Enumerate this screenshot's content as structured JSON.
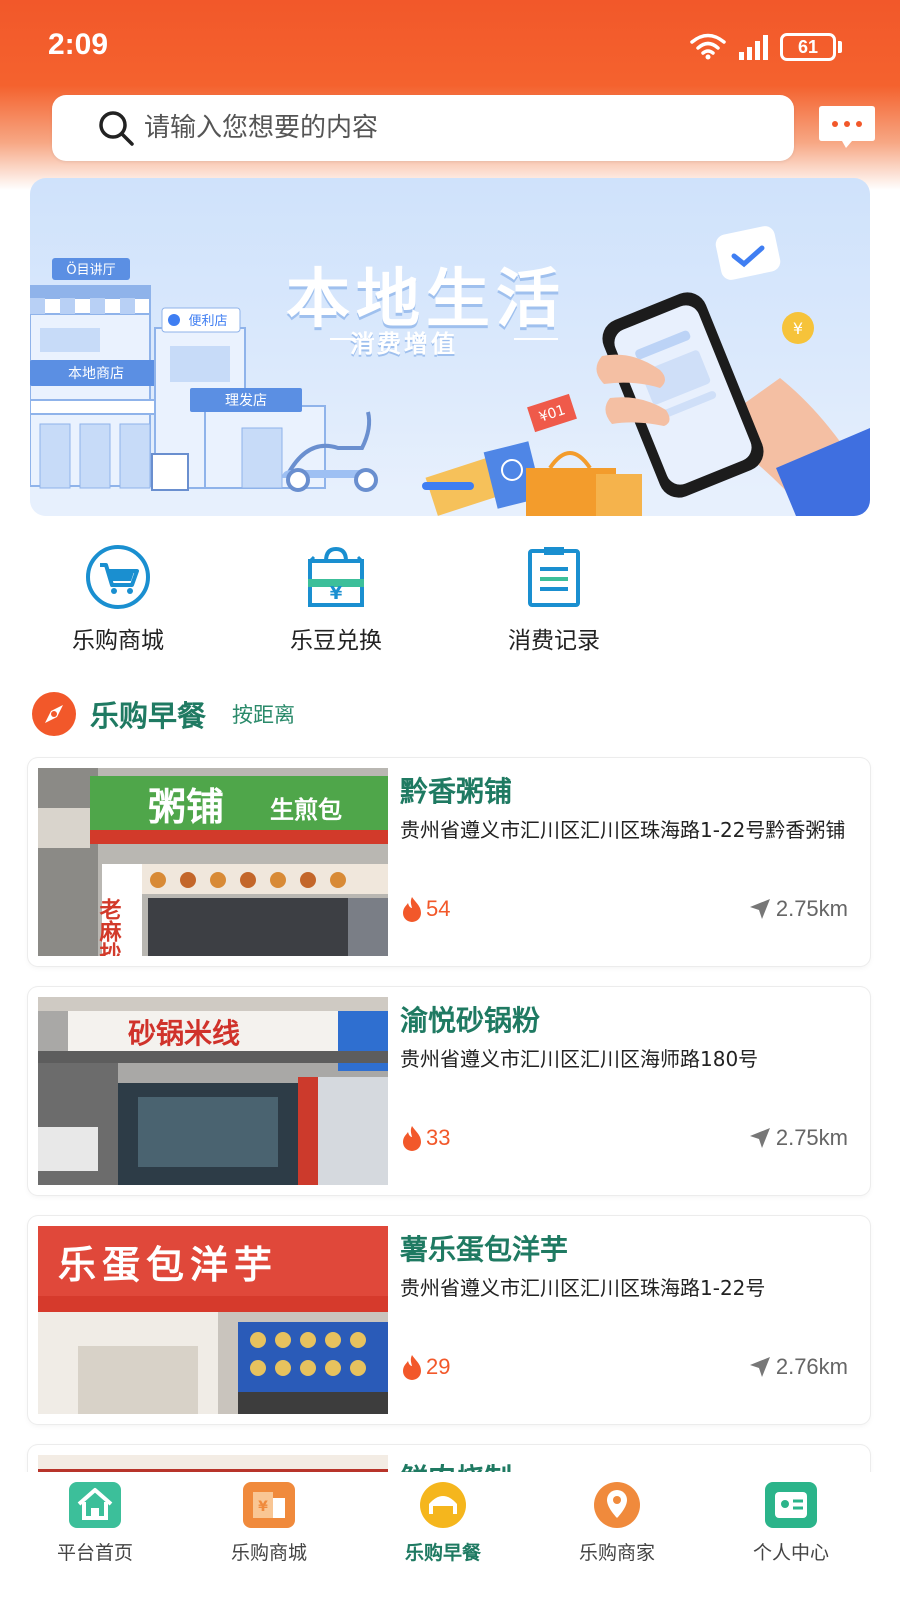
{
  "status_bar": {
    "time": "2:09",
    "battery": "61"
  },
  "search": {
    "placeholder": "请输入您想要的内容"
  },
  "banner": {
    "title": "本地生活",
    "subtitle": "消费增值",
    "sign_coffee": "Ö目讲厅",
    "sign_convenience": "便利店",
    "sign_local": "本地商店",
    "sign_barber": "理发店",
    "coupon": "¥01"
  },
  "quick_actions": [
    {
      "label": "乐购商城",
      "icon": "cart-icon"
    },
    {
      "label": "乐豆兑换",
      "icon": "shopping-bag-yen-icon"
    },
    {
      "label": "消费记录",
      "icon": "clipboard-icon"
    }
  ],
  "section": {
    "title": "乐购早餐",
    "sort": "按距离"
  },
  "shops": [
    {
      "name": "黔香粥铺",
      "address": "贵州省遵义市汇川区汇川区珠海路1-22号黔香粥铺",
      "heat": "54",
      "distance": "2.75km",
      "photo_sign": "粥铺",
      "photo_sign_small": "生煎包",
      "photo_side": "老麻抄"
    },
    {
      "name": "渝悦砂锅粉",
      "address": "贵州省遵义市汇川区汇川区海师路180号",
      "heat": "33",
      "distance": "2.75km",
      "photo_sign": "砂锅米线"
    },
    {
      "name": "薯乐蛋包洋芋",
      "address": "贵州省遵义市汇川区汇川区珠海路1-22号",
      "heat": "29",
      "distance": "2.76km",
      "photo_sign": "乐蛋包洋芋"
    },
    {
      "name": "鲜肉烧制",
      "address": "",
      "heat": "",
      "distance": ""
    }
  ],
  "tabs": [
    {
      "label": "平台首页",
      "icon": "home-icon",
      "color": "#3cbf9a"
    },
    {
      "label": "乐购商城",
      "icon": "store-icon",
      "color": "#f08a3c"
    },
    {
      "label": "乐购早餐",
      "icon": "breakfast-icon",
      "color": "#f5b61d"
    },
    {
      "label": "乐购商家",
      "icon": "location-pin-icon",
      "color": "#f08a3c"
    },
    {
      "label": "个人中心",
      "icon": "profile-card-icon",
      "color": "#2bb48a"
    }
  ],
  "colors": {
    "header": "#f2582a",
    "accent_green": "#1f7a62",
    "blue": "#1a8fd0",
    "heat": "#f2582a"
  }
}
